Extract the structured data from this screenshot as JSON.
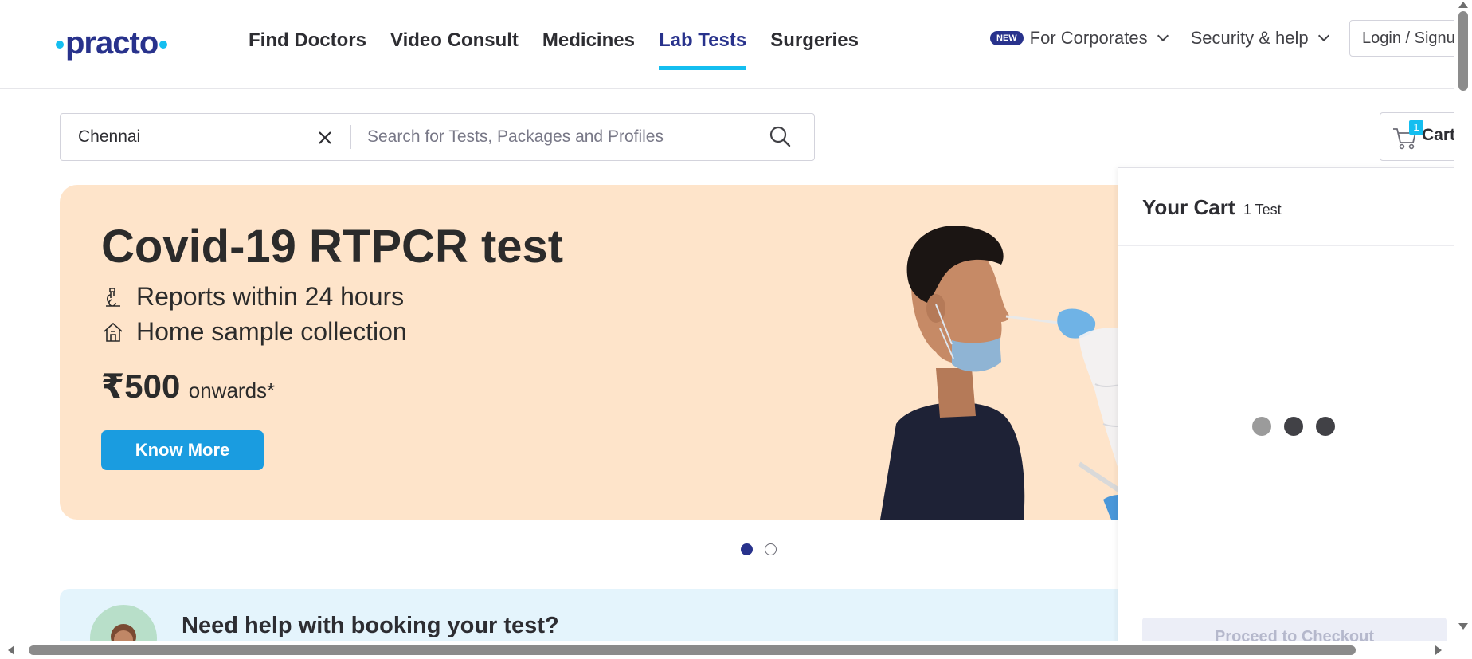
{
  "header": {
    "logo": "practo",
    "nav": [
      {
        "label": "Find Doctors",
        "active": false
      },
      {
        "label": "Video Consult",
        "active": false
      },
      {
        "label": "Medicines",
        "active": false
      },
      {
        "label": "Lab Tests",
        "active": true
      },
      {
        "label": "Surgeries",
        "active": false
      }
    ],
    "new_badge": "NEW",
    "corporates_label": "For Corporates",
    "security_label": "Security & help",
    "login_label": "Login / Signup"
  },
  "search": {
    "location_value": "Chennai",
    "query_placeholder": "Search for Tests, Packages and Profiles",
    "clear_icon": "close-icon",
    "search_icon": "search-icon"
  },
  "cart_button": {
    "label": "Cart",
    "count": "1"
  },
  "banner": {
    "title": "Covid-19 RTPCR test",
    "features": [
      {
        "icon": "microscope-icon",
        "text": "Reports within 24 hours"
      },
      {
        "icon": "home-icon",
        "text": "Home sample collection"
      }
    ],
    "price": "₹500",
    "price_suffix": "onwards*",
    "cta": "Know More",
    "background": "#fee4ca",
    "cta_color": "#1a9ce0"
  },
  "carousel": {
    "total": 2,
    "active": 1
  },
  "help": {
    "title": "Need help with booking your test?"
  },
  "cart_drawer": {
    "title": "Your Cart",
    "subtitle": "1 Test",
    "checkout_label": "Proceed to Checkout"
  },
  "colors": {
    "brand_navy": "#28328c",
    "brand_cyan": "#14bef0"
  }
}
